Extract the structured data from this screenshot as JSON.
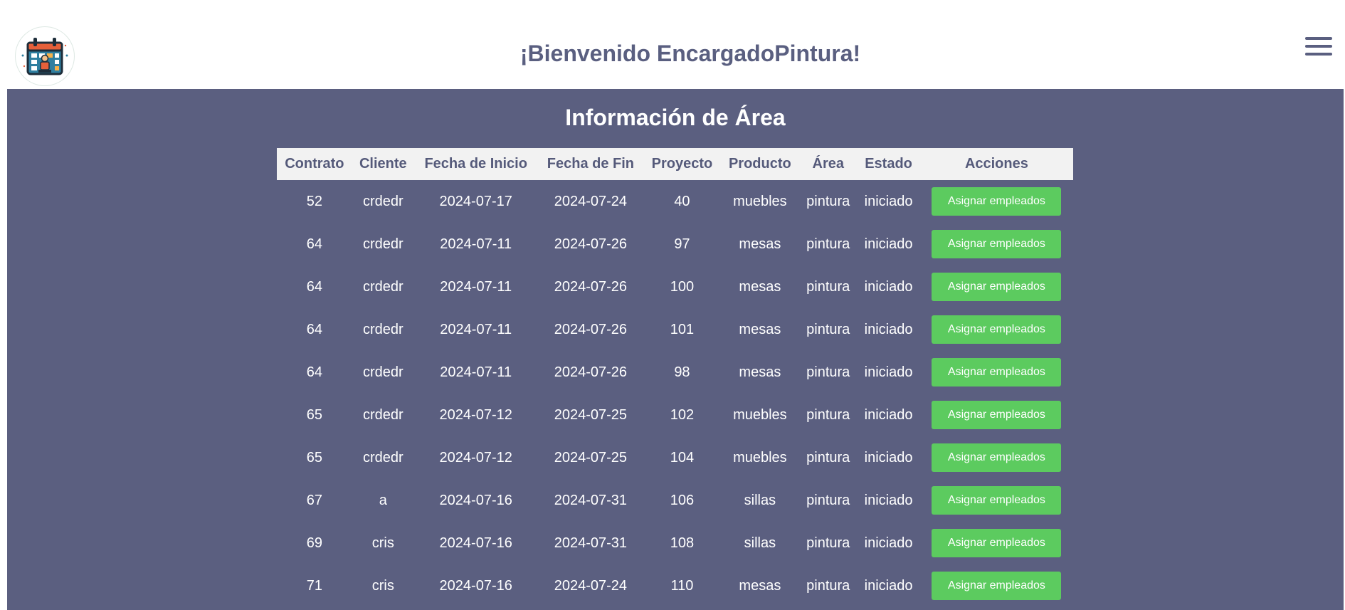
{
  "header": {
    "welcome": "¡Bienvenido EncargadoPintura!"
  },
  "main": {
    "title": "Información de Área"
  },
  "table": {
    "columns": [
      "Contrato",
      "Cliente",
      "Fecha de Inicio",
      "Fecha de Fin",
      "Proyecto",
      "Producto",
      "Área",
      "Estado",
      "Acciones"
    ],
    "action_label": "Asignar empleados",
    "rows": [
      {
        "contrato": "52",
        "cliente": "crdedr",
        "inicio": "2024-07-17",
        "fin": "2024-07-24",
        "proyecto": "40",
        "producto": "muebles",
        "area": "pintura",
        "estado": "iniciado"
      },
      {
        "contrato": "64",
        "cliente": "crdedr",
        "inicio": "2024-07-11",
        "fin": "2024-07-26",
        "proyecto": "97",
        "producto": "mesas",
        "area": "pintura",
        "estado": "iniciado"
      },
      {
        "contrato": "64",
        "cliente": "crdedr",
        "inicio": "2024-07-11",
        "fin": "2024-07-26",
        "proyecto": "100",
        "producto": "mesas",
        "area": "pintura",
        "estado": "iniciado"
      },
      {
        "contrato": "64",
        "cliente": "crdedr",
        "inicio": "2024-07-11",
        "fin": "2024-07-26",
        "proyecto": "101",
        "producto": "mesas",
        "area": "pintura",
        "estado": "iniciado"
      },
      {
        "contrato": "64",
        "cliente": "crdedr",
        "inicio": "2024-07-11",
        "fin": "2024-07-26",
        "proyecto": "98",
        "producto": "mesas",
        "area": "pintura",
        "estado": "iniciado"
      },
      {
        "contrato": "65",
        "cliente": "crdedr",
        "inicio": "2024-07-12",
        "fin": "2024-07-25",
        "proyecto": "102",
        "producto": "muebles",
        "area": "pintura",
        "estado": "iniciado"
      },
      {
        "contrato": "65",
        "cliente": "crdedr",
        "inicio": "2024-07-12",
        "fin": "2024-07-25",
        "proyecto": "104",
        "producto": "muebles",
        "area": "pintura",
        "estado": "iniciado"
      },
      {
        "contrato": "67",
        "cliente": "a",
        "inicio": "2024-07-16",
        "fin": "2024-07-31",
        "proyecto": "106",
        "producto": "sillas",
        "area": "pintura",
        "estado": "iniciado"
      },
      {
        "contrato": "69",
        "cliente": "cris",
        "inicio": "2024-07-16",
        "fin": "2024-07-31",
        "proyecto": "108",
        "producto": "sillas",
        "area": "pintura",
        "estado": "iniciado"
      },
      {
        "contrato": "71",
        "cliente": "cris",
        "inicio": "2024-07-16",
        "fin": "2024-07-24",
        "proyecto": "110",
        "producto": "mesas",
        "area": "pintura",
        "estado": "iniciado"
      }
    ]
  },
  "colors": {
    "header_text": "#5a5f80",
    "main_bg": "#5b5f80",
    "table_header_bg": "#f2f2f2",
    "button_bg": "#5ccb5f"
  },
  "icons": {
    "logo": "calendar-worker-logo-icon",
    "menu": "hamburger-menu-icon"
  }
}
